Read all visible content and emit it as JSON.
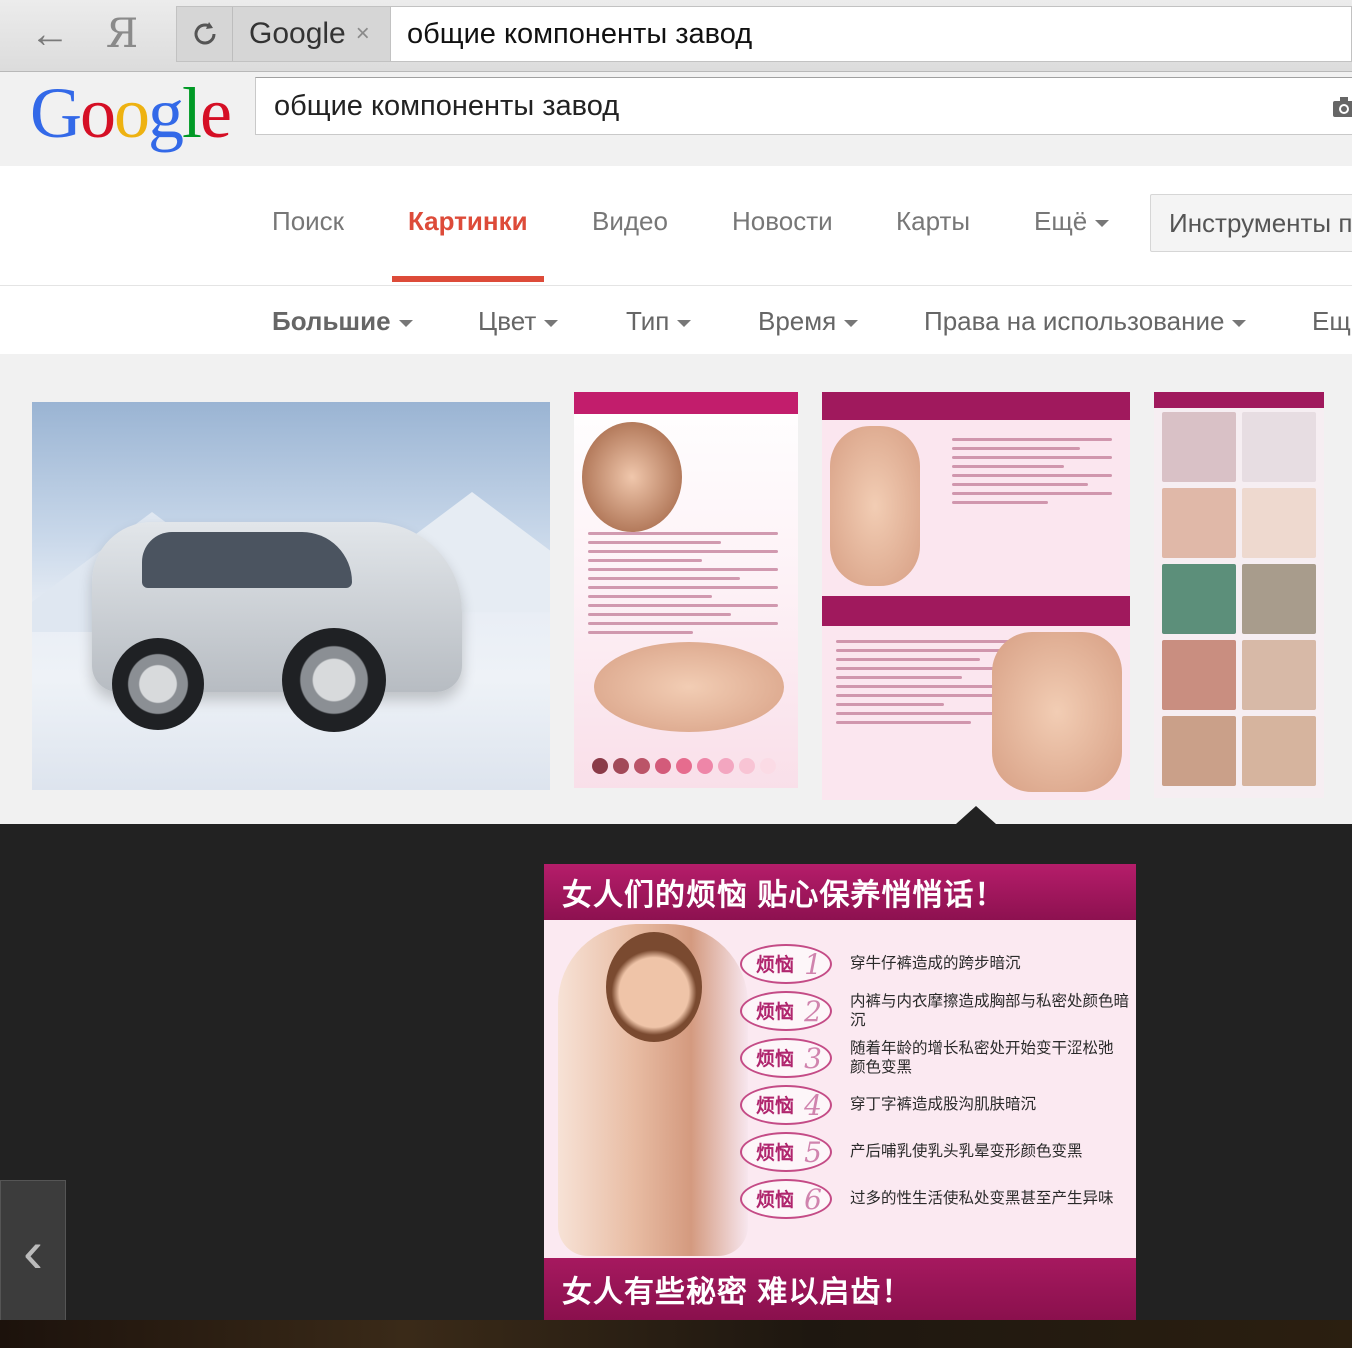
{
  "browser": {
    "tab_title": "Google",
    "tab_close": "×",
    "address": "общие компоненты завод",
    "back_glyph": "←",
    "yandex_glyph": "Я"
  },
  "google": {
    "logo": [
      "G",
      "o",
      "o",
      "g",
      "l",
      "e"
    ],
    "logo_colors": [
      "#3369e8",
      "#d50f25",
      "#eeb211",
      "#3369e8",
      "#009925",
      "#d50f25"
    ],
    "search_value": "общие компоненты завод"
  },
  "nav": {
    "items": [
      "Поиск",
      "Картинки",
      "Видео",
      "Новости",
      "Карты",
      "Ещё"
    ],
    "active": "Картинки",
    "tools": "Инструменты п",
    "accent": "#dd4b39"
  },
  "filters": {
    "items": [
      "Большие",
      "Цвет",
      "Тип",
      "Время",
      "Права на использование",
      "Ещ"
    ]
  },
  "preview": {
    "header": "女人们的烦恼 贴心保养悄悄话！",
    "footer": "女人有些秘密 难以启齿！",
    "badge_label": "烦恼",
    "rows": [
      {
        "num": "1",
        "text": "穿牛仔裤造成的跨步暗沉"
      },
      {
        "num": "2",
        "text": "内裤与内衣摩擦造成胸部与私密处颜色暗沉"
      },
      {
        "num": "3",
        "text": "随着年龄的增长私密处开始变干涩松弛 颜色变黑"
      },
      {
        "num": "4",
        "text": "穿丁字裤造成股沟肌肤暗沉"
      },
      {
        "num": "5",
        "text": "产后哺乳使乳头乳晕变形颜色变黑"
      },
      {
        "num": "6",
        "text": "过多的性生活使私处变黑甚至产生异味"
      }
    ],
    "prev_glyph": "‹"
  }
}
